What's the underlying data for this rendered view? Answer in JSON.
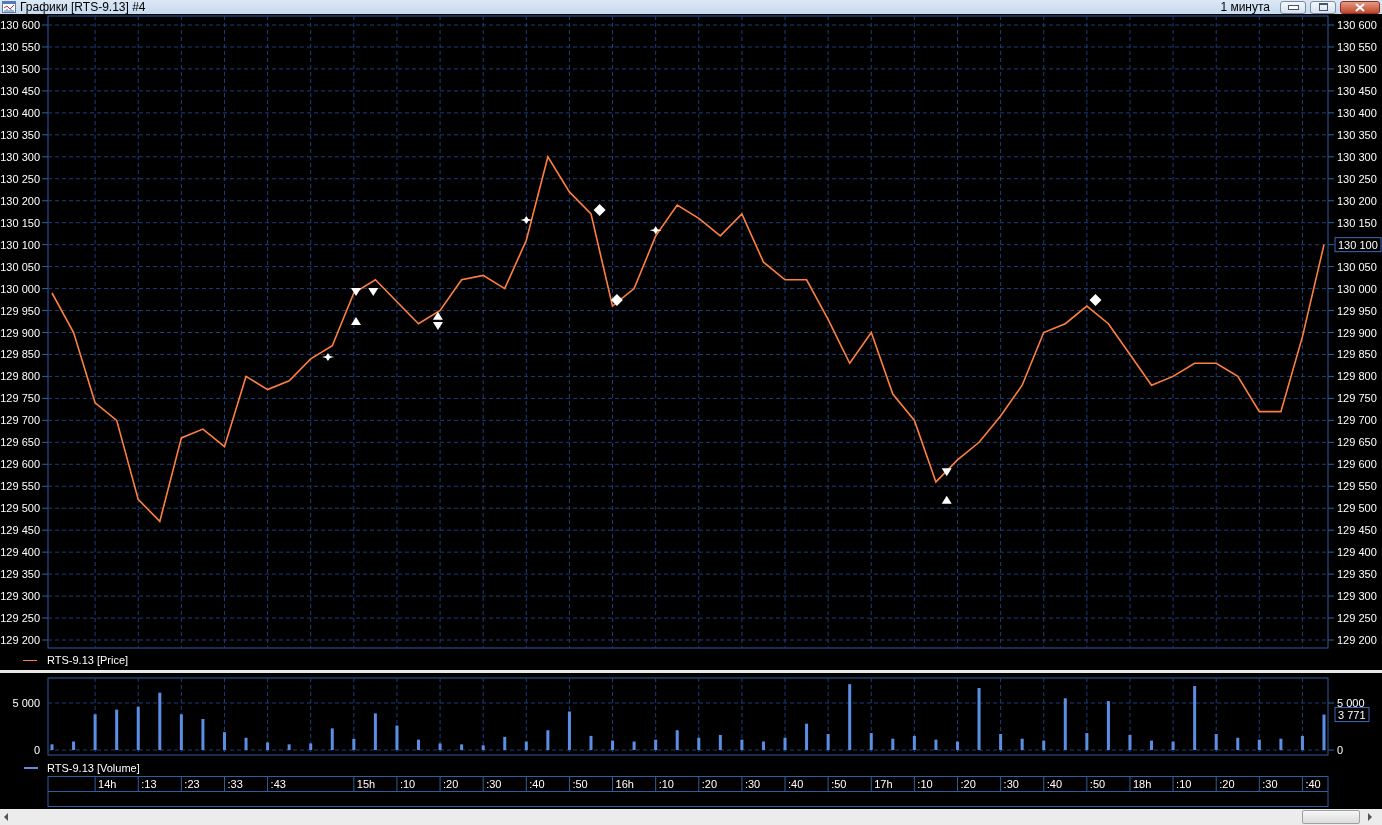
{
  "window": {
    "title": "Графики [RTS-9.13] #4",
    "timeframe": "1 минута"
  },
  "price_pane": {
    "last_value_label": "130 100",
    "chart_data": {
      "type": "line",
      "grid": true,
      "ylim": [
        129200,
        130600
      ],
      "categories": [
        null,
        null,
        null,
        null,
        null,
        null,
        null,
        null,
        null,
        null,
        null,
        null,
        null,
        null,
        null,
        null,
        null,
        null,
        null,
        null,
        null,
        null,
        null,
        null,
        null,
        null,
        null,
        null,
        null,
        null,
        null,
        null,
        null,
        null,
        null,
        null,
        null,
        null,
        null,
        null,
        null,
        null,
        null,
        null,
        null,
        null,
        null,
        null,
        null,
        null,
        null,
        null,
        null,
        null,
        null,
        null,
        null,
        null,
        null,
        null
      ],
      "yticks": [
        {
          "value": 130600,
          "label": "130 600"
        },
        {
          "value": 130550,
          "label": "130 550"
        },
        {
          "value": 130500,
          "label": "130 500"
        },
        {
          "value": 130450,
          "label": "130 450"
        },
        {
          "value": 130400,
          "label": "130 400"
        },
        {
          "value": 130350,
          "label": "130 350"
        },
        {
          "value": 130300,
          "label": "130 300"
        },
        {
          "value": 130250,
          "label": "130 250"
        },
        {
          "value": 130200,
          "label": "130 200"
        },
        {
          "value": 130150,
          "label": "130 150"
        },
        {
          "value": 130100,
          "label": "130 100"
        },
        {
          "value": 130050,
          "label": "130 050"
        },
        {
          "value": 130000,
          "label": "130 000"
        },
        {
          "value": 129950,
          "label": "129 950"
        },
        {
          "value": 129900,
          "label": "129 900"
        },
        {
          "value": 129850,
          "label": "129 850"
        },
        {
          "value": 129800,
          "label": "129 800"
        },
        {
          "value": 129750,
          "label": "129 750"
        },
        {
          "value": 129700,
          "label": "129 700"
        },
        {
          "value": 129650,
          "label": "129 650"
        },
        {
          "value": 129600,
          "label": "129 600"
        },
        {
          "value": 129550,
          "label": "129 550"
        },
        {
          "value": 129500,
          "label": "129 500"
        },
        {
          "value": 129450,
          "label": "129 450"
        },
        {
          "value": 129400,
          "label": "129 400"
        },
        {
          "value": 129350,
          "label": "129 350"
        },
        {
          "value": 129300,
          "label": "129 300"
        },
        {
          "value": 129250,
          "label": "129 250"
        },
        {
          "value": 129200,
          "label": "129 200"
        }
      ],
      "series": [
        {
          "name": "RTS-9.13 [Price]",
          "color": "#ff7f3f",
          "values": [
            129990,
            129900,
            129740,
            129700,
            129520,
            129470,
            129660,
            129680,
            129640,
            129800,
            129770,
            129790,
            129840,
            129870,
            129990,
            130020,
            129970,
            129920,
            129950,
            130020,
            130030,
            130000,
            130110,
            130300,
            130220,
            130170,
            129960,
            130000,
            130120,
            130190,
            130160,
            130120,
            130170,
            130060,
            130020,
            130020,
            129930,
            129830,
            129900,
            129760,
            129700,
            129560,
            129610,
            129650,
            129710,
            129780,
            129900,
            129920,
            129960,
            129920,
            129850,
            129780,
            129800,
            129830,
            129830,
            129800,
            129720,
            129720,
            129890,
            130100
          ]
        }
      ]
    }
  },
  "volume_pane": {
    "last_value_label": "3 771",
    "chart_data": {
      "type": "bar",
      "grid": true,
      "ylim": [
        0,
        7660
      ],
      "categories": [
        null,
        null,
        "14h",
        null,
        ":13",
        null,
        ":23",
        null,
        ":33",
        null,
        ":43",
        null,
        null,
        null,
        "15h",
        null,
        ":10",
        null,
        ":20",
        null,
        ":30",
        null,
        ":40",
        null,
        ":50",
        null,
        "16h",
        null,
        ":10",
        null,
        ":20",
        null,
        ":30",
        null,
        ":40",
        null,
        ":50",
        null,
        "17h",
        null,
        ":10",
        null,
        ":20",
        null,
        ":30",
        null,
        ":40",
        null,
        ":50",
        null,
        "18h",
        null,
        ":10",
        null,
        ":20",
        null,
        ":30",
        null,
        ":40",
        null
      ],
      "yticks": [
        {
          "value": 0,
          "label": "0"
        },
        {
          "value": 5000,
          "label": "5 000"
        }
      ],
      "series": [
        {
          "name": "RTS-9.13 [Volume]",
          "color": "#5b8fe6",
          "values": [
            600,
            900,
            3800,
            4300,
            4600,
            6100,
            3800,
            3300,
            1900,
            1300,
            800,
            600,
            700,
            2300,
            1200,
            3900,
            2600,
            1100,
            700,
            600,
            500,
            1400,
            900,
            2100,
            4100,
            1500,
            1000,
            900,
            1100,
            2100,
            1300,
            1600,
            1100,
            900,
            1300,
            2800,
            1700,
            7000,
            1800,
            1200,
            1500,
            1100,
            900,
            6600,
            1700,
            1200,
            1000,
            5500,
            1800,
            5200,
            1600,
            1000,
            900,
            6800,
            1700,
            1300,
            1100,
            1200,
            1500,
            3771
          ]
        }
      ]
    }
  }
}
